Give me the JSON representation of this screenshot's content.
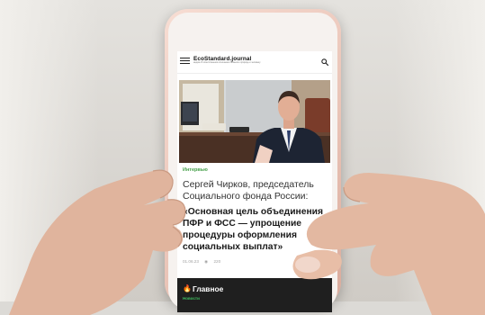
{
  "site": {
    "logo": "EcoStandard.journal",
    "tagline": "медиа об ответственном отношении бизнеса к природе и человеку"
  },
  "article": {
    "tag": "Интервью",
    "headline": "Сергей Чирков, председатель Социального фонда России:",
    "quote": "«Основная цель объединения ПФР и ФСС — упрощение процедуры оформления социальных выплат»",
    "date": "01.06.23",
    "views": "220"
  },
  "section": {
    "title": "Главное",
    "label": "Новости"
  },
  "colors": {
    "tag": "#47a14b",
    "dark_section": "#1f1f1f",
    "phone_case": "#e9c3b6"
  }
}
